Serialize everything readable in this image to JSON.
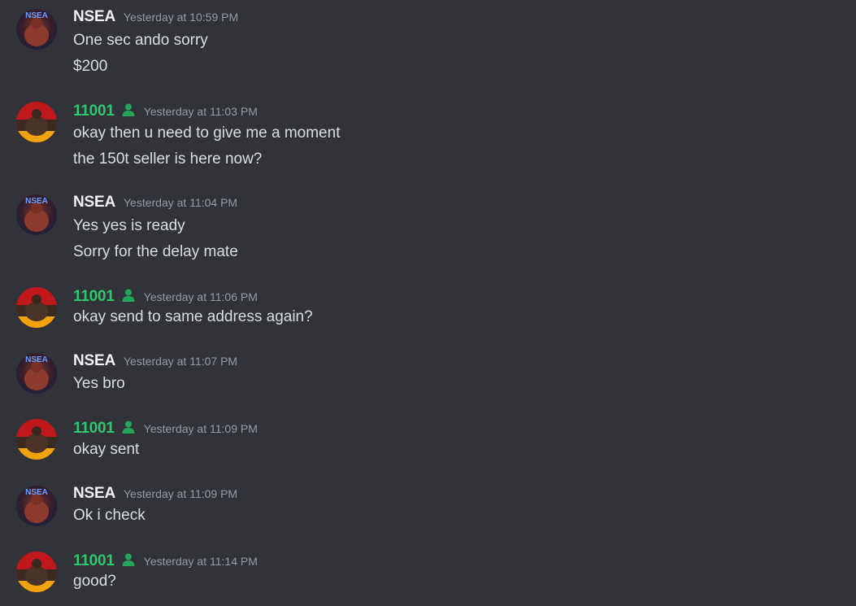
{
  "messages": [
    {
      "author": "NSEA",
      "author_type": "nsea",
      "timestamp": "Yesterday at 10:59 PM",
      "lines": [
        "One sec ando sorry",
        "$200"
      ]
    },
    {
      "author": "11001",
      "author_type": "green",
      "timestamp": "Yesterday at 11:03 PM",
      "lines": [
        "okay then u need to give me a moment",
        "the 150t seller is here now?"
      ]
    },
    {
      "author": "NSEA",
      "author_type": "nsea",
      "timestamp": "Yesterday at 11:04 PM",
      "lines": [
        "Yes yes is ready",
        "Sorry for the delay mate"
      ]
    },
    {
      "author": "11001",
      "author_type": "green",
      "timestamp": "Yesterday at 11:06 PM",
      "lines": [
        "okay send to same address again?"
      ]
    },
    {
      "author": "NSEA",
      "author_type": "nsea",
      "timestamp": "Yesterday at 11:07 PM",
      "lines": [
        "Yes bro"
      ]
    },
    {
      "author": "11001",
      "author_type": "green",
      "timestamp": "Yesterday at 11:09 PM",
      "lines": [
        "okay sent"
      ]
    },
    {
      "author": "NSEA",
      "author_type": "nsea",
      "timestamp": "Yesterday at 11:09 PM",
      "lines": [
        "Ok i check"
      ]
    },
    {
      "author": "11001",
      "author_type": "green",
      "timestamp": "Yesterday at 11:14 PM",
      "lines": [
        "good?"
      ]
    }
  ],
  "colors": {
    "background": "#313338",
    "username_nsea": "#f2f3f5",
    "username_green": "#2dc770",
    "timestamp": "#949ba4",
    "message_text": "#dbdee1",
    "role_icon": "#23a55a"
  },
  "icons": {
    "role_icon": "person-icon"
  }
}
